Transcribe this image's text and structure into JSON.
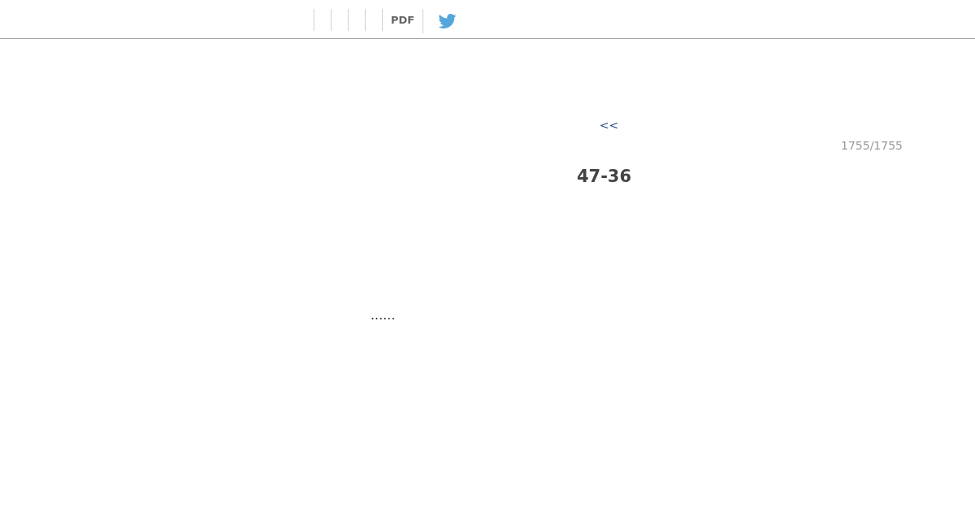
{
  "header": {
    "pdf_link": "PDF"
  },
  "navigation": {
    "previous_link": "<<"
  },
  "page_counter": "1755/1755",
  "title": "47-36",
  "body_text": "......"
}
